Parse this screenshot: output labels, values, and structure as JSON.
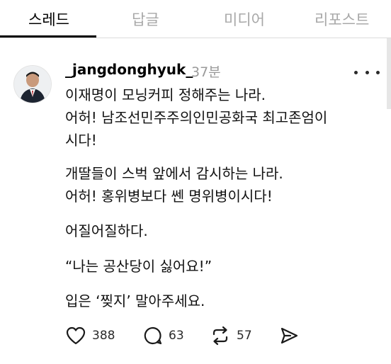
{
  "tabs": [
    {
      "label": "스레드",
      "active": true
    },
    {
      "label": "답글",
      "active": false
    },
    {
      "label": "미디어",
      "active": false
    },
    {
      "label": "리포스트",
      "active": false
    }
  ],
  "post": {
    "username": "_jangdonghyuk_",
    "time": "37분",
    "paragraphs": [
      "이재명이 모닝커피 정해주는 나라.\n어허! 남조선민주주의인민공화국 최고존엄이\n시다!",
      "개딸들이 스벅 앞에서 감시하는 나라.\n어허! 홍위병보다 쎈 명위병이시다!",
      "어질어질하다.",
      "“나는 공산당이 싫어요!”",
      "입은 ‘찢지’ 말아주세요."
    ],
    "actions": {
      "likes": "388",
      "comments": "63",
      "reposts": "57"
    }
  },
  "icons": [
    "heart-icon",
    "comment-icon",
    "repost-icon",
    "send-icon",
    "more-icon"
  ],
  "colors": {
    "active_tab": "#000000",
    "inactive_tab": "#a8a8a8",
    "muted": "#9a9a9a"
  }
}
